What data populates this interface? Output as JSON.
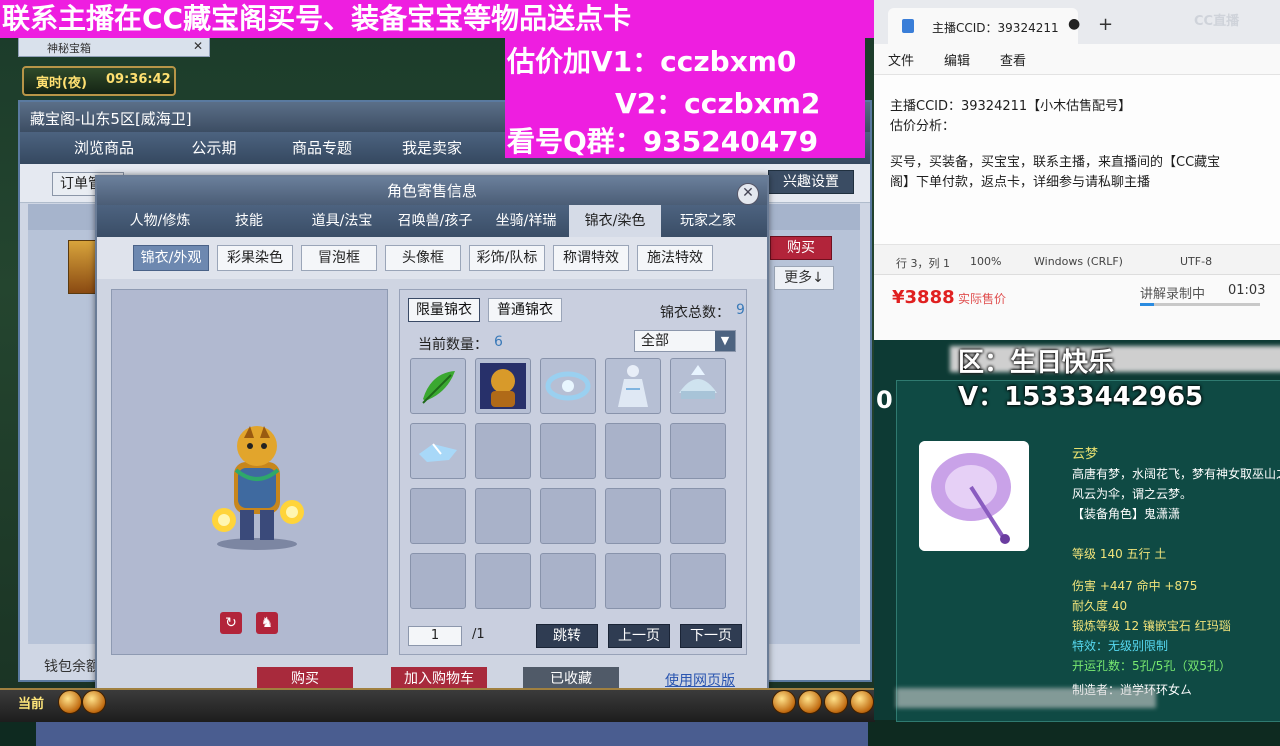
{
  "promo": {
    "line1": "联系主播在CC藏宝阁买号、装备宝宝等物品送点卡",
    "valuation_v1": "估价加V1：cczbxm0",
    "valuation_v2": "V2：cczbxm2",
    "qq_group": "看号Q群：935240479"
  },
  "game": {
    "time_label": "寅时(夜)",
    "time_value": "09:36:42",
    "browser_tab": "神秘宝箱",
    "bottom_current": "当前",
    "window_title": "藏宝阁-山东5区[威海卫]",
    "nav": [
      "浏览商品",
      "公示期",
      "商品专题",
      "我是卖家"
    ],
    "order_btn": "订单管理",
    "interest_btn": "兴趣设置",
    "buy_btn": "购买",
    "more_btn": "更多↓",
    "wallet_label": "钱包余额"
  },
  "dialog": {
    "title": "角色寄售信息",
    "tabs": [
      "人物/修炼",
      "技能",
      "道具/法宝",
      "召唤兽/孩子",
      "坐骑/祥瑞",
      "锦衣/染色",
      "玩家之家"
    ],
    "active_tab": 5,
    "subtabs": [
      "锦衣/外观",
      "彩果染色",
      "冒泡框",
      "头像框",
      "彩饰/队标",
      "称谓特效",
      "施法特效"
    ],
    "active_subtab": 0,
    "limited_btn": "限量锦衣",
    "normal_btn": "普通锦衣",
    "total_label": "锦衣总数：",
    "total_value": "9",
    "qty_label": "当前数量：",
    "qty_value": "6",
    "filter": "全部",
    "page_current": "1",
    "page_total": "/1",
    "jump_btn": "跳转",
    "prev_btn": "上一页",
    "next_btn": "下一页",
    "footer": {
      "buy": "购买",
      "add_cart": "加入购物车",
      "favorited": "已收藏",
      "web_link": "使用网页版"
    },
    "items": [
      {
        "icon": "green-leaf-icon",
        "color": "#3aa830"
      },
      {
        "icon": "tiger-portrait-icon",
        "color": "#c8881c"
      },
      {
        "icon": "blue-swirl-icon",
        "color": "#9ad0f0"
      },
      {
        "icon": "white-robe-icon",
        "color": "#dfe8f4"
      },
      {
        "icon": "silver-helmet-icon",
        "color": "#cfe3ef"
      },
      {
        "icon": "crystal-shard-icon",
        "color": "#a8d8f8"
      }
    ]
  },
  "notepad": {
    "tab_title": "主播CCID：39324211",
    "menu": [
      "文件",
      "编辑",
      "查看"
    ],
    "logo": "CC直播",
    "lines": [
      "主播CCID：39324211【小木估售配号】",
      "估价分析：",
      "",
      "买号，买装备，买宝宝，联系主播，来直播间的【CC藏宝",
      "阁】下单付款，返点卡，详细参与请私聊主播"
    ],
    "status": [
      "行 3，列 1",
      "100%",
      "Windows (CRLF)",
      "UTF-8"
    ]
  },
  "stream": {
    "price": "¥3888",
    "price_label": "实际售价",
    "rec_label": "讲解录制中",
    "rec_time": "01:03",
    "rec_progress": 0.12
  },
  "overlay": {
    "zone": "区：生日快乐",
    "v": "V：15333442965",
    "zero": "0"
  },
  "tooltip": {
    "name": "云梦",
    "lines": [
      {
        "text": "高唐有梦，水阔花飞，梦有神女取巫山之",
        "style": "white"
      },
      {
        "text": "风云为伞，谓之云梦。",
        "style": "white"
      },
      {
        "text": "【装备角色】鬼潇潇",
        "style": "white"
      },
      {
        "text": "等级 140 五行 土",
        "style": "yellow"
      },
      {
        "text": "伤害 +447 命中 +875",
        "style": "yellow"
      },
      {
        "text": "耐久度 40",
        "style": "yellow"
      },
      {
        "text": "锻炼等级 12 镶嵌宝石 红玛瑙",
        "style": "yellow"
      },
      {
        "text": "特效：无级别限制",
        "style": "cyan"
      },
      {
        "text": "开运孔数：5孔/5孔（双5孔）",
        "style": "green"
      },
      {
        "text": "制造者：逍学环环女ㄙ",
        "style": "white"
      }
    ]
  }
}
